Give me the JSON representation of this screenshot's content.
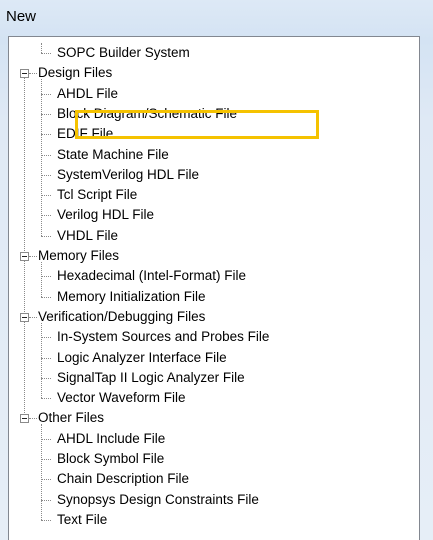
{
  "window": {
    "title": "New"
  },
  "tree": [
    {
      "label": "SOPC Builder System",
      "level": 1,
      "last": false
    },
    {
      "label": "Design Files",
      "level": 0,
      "expanded": true,
      "last": false,
      "children": [
        "AHDL File",
        "Block Diagram/Schematic File",
        "EDIF File",
        "State Machine File",
        "SystemVerilog HDL File",
        "Tcl Script File",
        "Verilog HDL File",
        "VHDL File"
      ]
    },
    {
      "label": "Memory Files",
      "level": 0,
      "expanded": true,
      "last": false,
      "children": [
        "Hexadecimal (Intel-Format) File",
        "Memory Initialization File"
      ]
    },
    {
      "label": "Verification/Debugging Files",
      "level": 0,
      "expanded": true,
      "last": false,
      "children": [
        "In-System Sources and Probes File",
        "Logic Analyzer Interface File",
        "SignalTap II Logic Analyzer File",
        "Vector Waveform File"
      ]
    },
    {
      "label": "Other Files",
      "level": 0,
      "expanded": true,
      "last": true,
      "children": [
        "AHDL Include File",
        "Block Symbol File",
        "Chain Description File",
        "Synopsys Design Constraints File",
        "Text File"
      ]
    }
  ],
  "highlighted_item": "Block Diagram/Schematic File",
  "colors": {
    "highlight": "#f5c200",
    "tree_lines": "#8a8a8a",
    "dialog_bg": "#dde9f6"
  }
}
